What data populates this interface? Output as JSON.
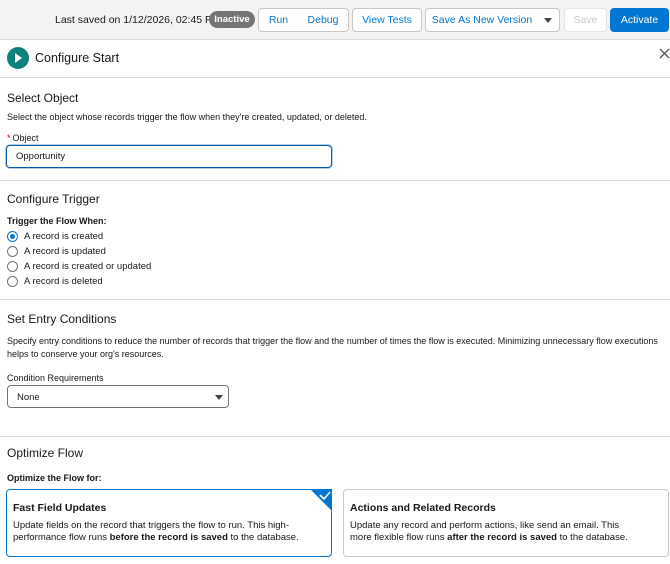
{
  "toolbar": {
    "last_saved": "Last saved on 1/12/2026, 02:45 PM",
    "status_badge": "Inactive",
    "run_label": "Run",
    "debug_label": "Debug",
    "view_tests_label": "View Tests",
    "save_as_new_version_label": "Save As New Version",
    "save_label": "Save",
    "activate_label": "Activate"
  },
  "header": {
    "title": "Configure Start",
    "icon": "play-icon",
    "close_icon": "close-icon"
  },
  "select_object": {
    "title": "Select Object",
    "description": "Select the object whose records trigger the flow when they're created, updated, or deleted.",
    "field_label": "Object",
    "required_mark": "*",
    "value": "Opportunity"
  },
  "configure_trigger": {
    "title": "Configure Trigger",
    "group_label": "Trigger the Flow When:",
    "options": [
      {
        "label": "A record is created",
        "checked": true
      },
      {
        "label": "A record is updated",
        "checked": false
      },
      {
        "label": "A record is created or updated",
        "checked": false
      },
      {
        "label": "A record is deleted",
        "checked": false
      }
    ]
  },
  "entry_conditions": {
    "title": "Set Entry Conditions",
    "description_line1": "Specify entry conditions to reduce the number of records that trigger the flow and the number of times the flow is executed. Minimizing unnecessary flow executions",
    "description_line2": "helps to conserve your org's resources.",
    "field_label": "Condition Requirements",
    "selected": "None"
  },
  "optimize": {
    "title": "Optimize Flow",
    "group_label": "Optimize the Flow for:",
    "cards": [
      {
        "title": "Fast Field Updates",
        "line1": "Update fields on the record that triggers the flow to run. This high-",
        "line2_prefix": "performance flow runs ",
        "line2_bold": "before the record is saved",
        "line2_suffix": " to the database.",
        "selected": true
      },
      {
        "title": "Actions and Related Records",
        "line1": "Update any record and perform actions, like send an email. This",
        "line2_prefix": "more flexible flow runs ",
        "line2_bold": "after the record is saved",
        "line2_suffix": " to the database.",
        "selected": false
      }
    ]
  },
  "colors": {
    "brand": "#0176d3",
    "flow_start": "#0b827c",
    "inactive_badge": "#747474"
  }
}
